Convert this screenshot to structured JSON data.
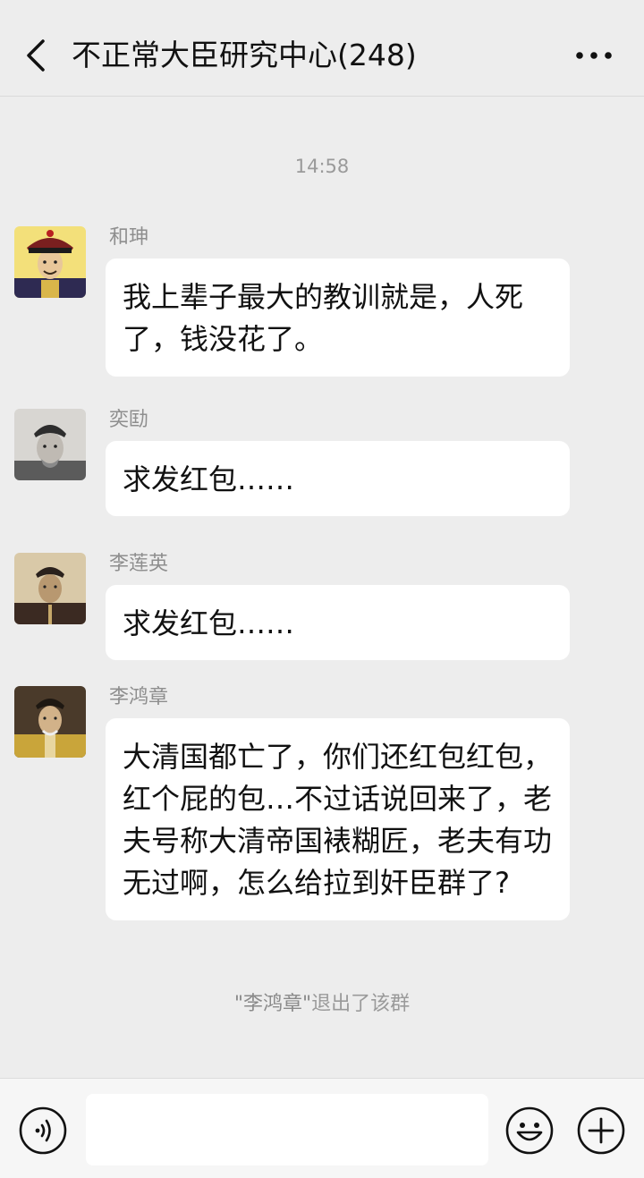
{
  "header": {
    "title": "不正常大臣研究中心(248)",
    "back_icon": "chevron-left-icon",
    "more_icon": "more-dots-icon"
  },
  "chat": {
    "timestamp": "14:58",
    "messages": [
      {
        "sender": "和珅",
        "text": "我上辈子最大的教训就是，人死了，钱没花了。",
        "avatar": "portrait-hat-red"
      },
      {
        "sender": "奕劻",
        "text": "求发红包……",
        "avatar": "portrait-grayscale"
      },
      {
        "sender": "李莲英",
        "text": "求发红包……",
        "avatar": "portrait-sepia"
      },
      {
        "sender": "李鸿章",
        "text": "大清国都亡了，你们还红包红包，红个屁的包…不过话说回来了，老夫号称大清帝国裱糊匠，老夫有功无过啊，怎么给拉到奸臣群了?",
        "avatar": "portrait-yellow-robe"
      }
    ],
    "system_note": {
      "quoted_name": "\"李鸿章\"",
      "suffix": "退出了该群"
    }
  },
  "input_bar": {
    "placeholder": "",
    "voice_icon": "voice-icon",
    "emoji_icon": "emoji-icon",
    "plus_icon": "plus-icon"
  },
  "colors": {
    "background": "#ededed",
    "bubble": "#ffffff",
    "meta_text": "#9a9a9a"
  }
}
